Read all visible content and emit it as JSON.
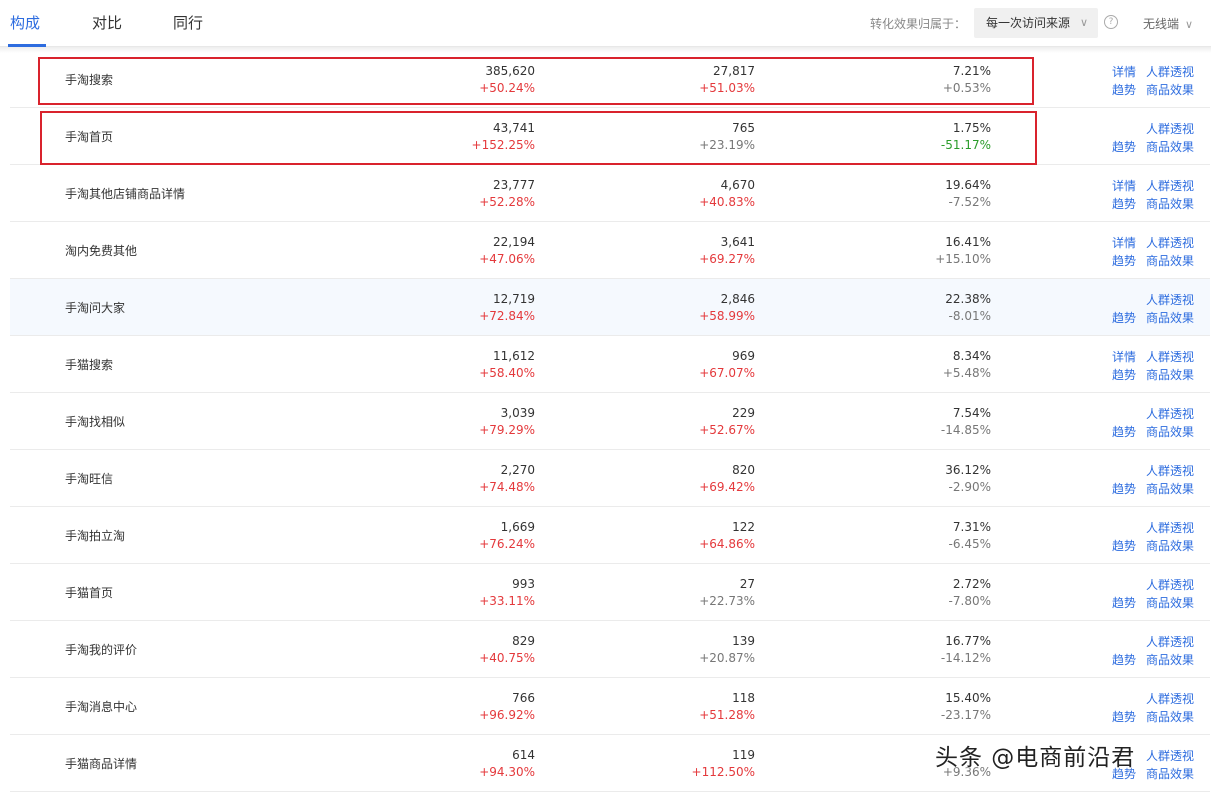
{
  "tabs": [
    "构成",
    "对比",
    "同行"
  ],
  "attribution": {
    "label": "转化效果归属于：",
    "selected": "每一次访问来源",
    "help": "?"
  },
  "device": "无线端",
  "links": {
    "detail": "详情",
    "crowd": "人群透视",
    "trend": "趋势",
    "goods": "商品效果"
  },
  "rows": [
    {
      "name": "手淘搜索",
      "v1": "385,620",
      "d1": "+50.24%",
      "v2": "27,817",
      "d2": "+51.03%",
      "v3": "7.21%",
      "d3": "+0.53%",
      "detail": true
    },
    {
      "name": "手淘首页",
      "v1": "43,741",
      "d1": "+152.25%",
      "v2": "765",
      "d2": "+23.19%",
      "v3": "1.75%",
      "d3": "-51.17%",
      "detail": false
    },
    {
      "name": "手淘其他店铺商品详情",
      "v1": "23,777",
      "d1": "+52.28%",
      "v2": "4,670",
      "d2": "+40.83%",
      "v3": "19.64%",
      "d3": "-7.52%",
      "detail": true
    },
    {
      "name": "淘内免费其他",
      "v1": "22,194",
      "d1": "+47.06%",
      "v2": "3,641",
      "d2": "+69.27%",
      "v3": "16.41%",
      "d3": "+15.10%",
      "detail": true
    },
    {
      "name": "手淘问大家",
      "v1": "12,719",
      "d1": "+72.84%",
      "v2": "2,846",
      "d2": "+58.99%",
      "v3": "22.38%",
      "d3": "-8.01%",
      "detail": false
    },
    {
      "name": "手猫搜索",
      "v1": "11,612",
      "d1": "+58.40%",
      "v2": "969",
      "d2": "+67.07%",
      "v3": "8.34%",
      "d3": "+5.48%",
      "detail": true
    },
    {
      "name": "手淘找相似",
      "v1": "3,039",
      "d1": "+79.29%",
      "v2": "229",
      "d2": "+52.67%",
      "v3": "7.54%",
      "d3": "-14.85%",
      "detail": false
    },
    {
      "name": "手淘旺信",
      "v1": "2,270",
      "d1": "+74.48%",
      "v2": "820",
      "d2": "+69.42%",
      "v3": "36.12%",
      "d3": "-2.90%",
      "detail": false
    },
    {
      "name": "手淘拍立淘",
      "v1": "1,669",
      "d1": "+76.24%",
      "v2": "122",
      "d2": "+64.86%",
      "v3": "7.31%",
      "d3": "-6.45%",
      "detail": false
    },
    {
      "name": "手猫首页",
      "v1": "993",
      "d1": "+33.11%",
      "v2": "27",
      "d2": "+22.73%",
      "v3": "2.72%",
      "d3": "-7.80%",
      "detail": false
    },
    {
      "name": "手淘我的评价",
      "v1": "829",
      "d1": "+40.75%",
      "v2": "139",
      "d2": "+20.87%",
      "v3": "16.77%",
      "d3": "-14.12%",
      "detail": false
    },
    {
      "name": "手淘消息中心",
      "v1": "766",
      "d1": "+96.92%",
      "v2": "118",
      "d2": "+51.28%",
      "v3": "15.40%",
      "d3": "-23.17%",
      "detail": false
    },
    {
      "name": "手猫商品详情",
      "v1": "614",
      "d1": "+94.30%",
      "v2": "119",
      "d2": "+112.50%",
      "v3": "",
      "d3": "+9.36%",
      "detail": false
    }
  ],
  "colors": {
    "accent": "#2d6cdf",
    "up": "#e4393c",
    "down": "#2b9c2b",
    "highlight": "#d9232d"
  },
  "watermark": "头条 @电商前沿君"
}
